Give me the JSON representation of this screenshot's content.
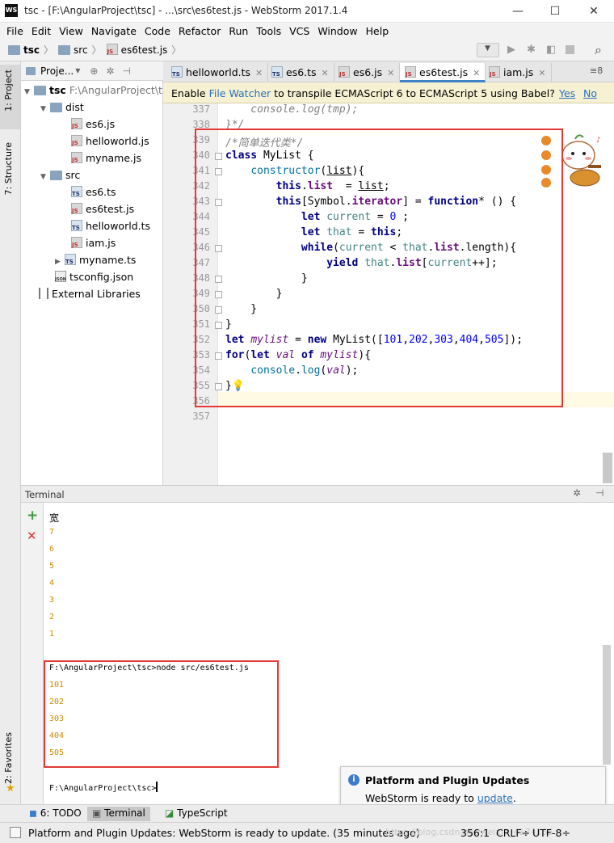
{
  "window": {
    "app_icon": "WS",
    "title": "tsc - [F:\\AngularProject\\tsc] - ...\\src\\es6test.js - WebStorm 2017.1.4"
  },
  "menu": [
    "File",
    "Edit",
    "View",
    "Navigate",
    "Code",
    "Refactor",
    "Run",
    "Tools",
    "VCS",
    "Window",
    "Help"
  ],
  "breadcrumb": [
    "tsc",
    "src",
    "es6test.js"
  ],
  "project_panel": {
    "header_label": "Proje...",
    "tree": {
      "root": "tsc",
      "root_path": "F:\\AngularProject\\t",
      "dist": "dist",
      "dist_files": [
        "es6.js",
        "helloworld.js",
        "myname.js"
      ],
      "src": "src",
      "src_files": [
        "es6.ts",
        "es6test.js",
        "helloworld.ts",
        "iam.js",
        "myname.ts"
      ],
      "tsconfig": "tsconfig.json",
      "external": "External Libraries"
    }
  },
  "left_strip": {
    "project": "1: Project",
    "structure": "7: Structure",
    "favorites": "2: Favorites"
  },
  "editor_tabs": [
    "helloworld.ts",
    "es6.ts",
    "es6.js",
    "es6test.js",
    "iam.js"
  ],
  "active_tab": "es6test.js",
  "tabs_overflow": "≡8",
  "banner": {
    "pre": "Enable ",
    "link": "File Watcher",
    "post": " to transpile ECMAScript 6 to ECMAScript 5 using Babel?",
    "yes": "Yes",
    "no": "No"
  },
  "code": {
    "line_numbers": [
      "337",
      "338",
      "339",
      "340",
      "341",
      "342",
      "343",
      "344",
      "345",
      "346",
      "347",
      "348",
      "349",
      "350",
      "351",
      "352",
      "353",
      "354",
      "355",
      "356",
      "357"
    ],
    "comment_title": "简单迭代类"
  },
  "terminal": {
    "label": "Terminal",
    "lines_before": [
      "宽",
      "7",
      "6",
      "5",
      "4",
      "3",
      "2",
      "1"
    ],
    "command": "F:\\AngularProject\\tsc>node src/es6test.js",
    "output": [
      "101",
      "202",
      "303",
      "404",
      "505"
    ],
    "prompt": "F:\\AngularProject\\tsc>"
  },
  "popup": {
    "title": "Platform and Plugin Updates",
    "text": "WebStorm is ready to ",
    "link": "update",
    "dot": "."
  },
  "bottom_tabs": [
    "6: TODO",
    "Terminal",
    "TypeScript"
  ],
  "status": {
    "message": "Platform and Plugin Updates: WebStorm is ready to update. (35 minutes ago)",
    "position": "356:1",
    "line_sep": "CRLF÷",
    "encoding": "UTF-8÷",
    "watermark": "https://blog.csdn.net/weixin_4174166"
  },
  "colors": {
    "highlight_box": "#e53935",
    "link": "#2a6fbd",
    "terminal_output": "#cc8a00"
  }
}
